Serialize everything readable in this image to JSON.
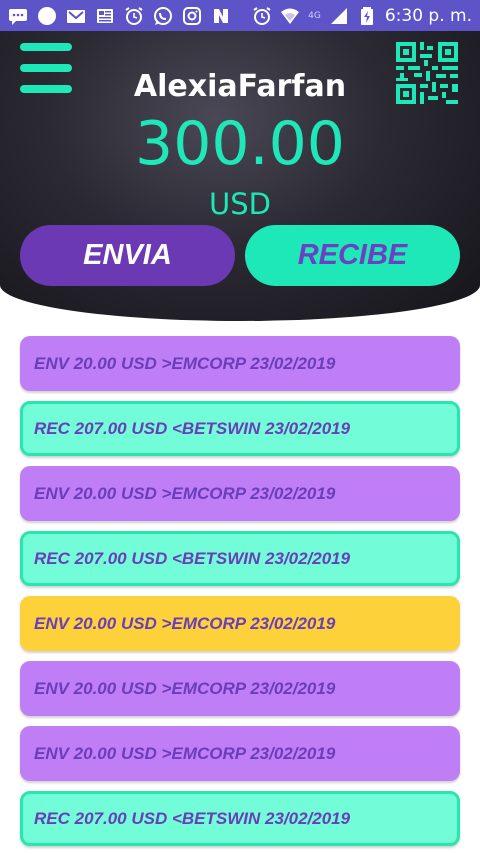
{
  "status_bar": {
    "time": "6:30 p. m.",
    "network": "4G",
    "left_icons": [
      "message-icon",
      "circle-icon",
      "gmail-icon",
      "news-icon",
      "alarm-icon",
      "whatsapp-icon",
      "instagram-icon",
      "n-app-icon"
    ],
    "right_icons": [
      "alarm-icon",
      "wifi-icon",
      "signal-icon",
      "battery-icon"
    ]
  },
  "header": {
    "username": "AlexiaFarfan",
    "balance": "300.00",
    "currency": "USD",
    "menu_icon": "hamburger-menu-icon",
    "qr_icon": "qr-code-icon"
  },
  "actions": {
    "send_label": "ENVIA",
    "receive_label": "RECIBE"
  },
  "transactions": [
    {
      "text": "ENV 20.00 USD >EMCORP 23/02/2019",
      "type": "env"
    },
    {
      "text": "REC 207.00 USD <BETSWIN 23/02/2019",
      "type": "rec"
    },
    {
      "text": "ENV 20.00 USD >EMCORP 23/02/2019",
      "type": "env"
    },
    {
      "text": "REC 207.00 USD <BETSWIN 23/02/2019",
      "type": "rec"
    },
    {
      "text": "ENV 20.00 USD >EMCORP 23/02/2019",
      "type": "selected"
    },
    {
      "text": "ENV 20.00 USD >EMCORP 23/02/2019",
      "type": "env"
    },
    {
      "text": "ENV 20.00 USD >EMCORP 23/02/2019",
      "type": "env"
    },
    {
      "text": "REC 207.00 USD <BETSWIN 23/02/2019",
      "type": "rec"
    }
  ],
  "colors": {
    "status_bar": "#5d54c8",
    "accent_green": "#1ee8b8",
    "send_purple": "#6a39b3",
    "env_row": "#c07ef6",
    "rec_row": "#72fcd7",
    "highlight_row": "#fdd139"
  }
}
